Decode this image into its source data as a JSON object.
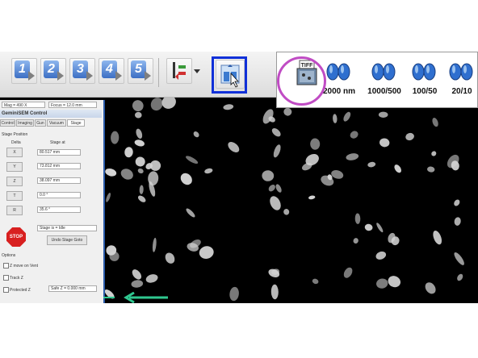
{
  "toolbar": {
    "numbers": [
      "1",
      "2",
      "3",
      "4",
      "5"
    ]
  },
  "mag_panel": {
    "items": [
      {
        "label": "2000 nm"
      },
      {
        "label": "1000/500"
      },
      {
        "label": "100/50"
      },
      {
        "label": "20/10"
      }
    ],
    "tiff_label": "TIFF"
  },
  "left_panel": {
    "mag_readout": "Mag =    490 X",
    "focus_readout": "Focus = 12.0 mm",
    "title": "GeminiSEM Control",
    "tabs": [
      "Control",
      "Imaging",
      "Gun",
      "Vacuum",
      "Stage"
    ],
    "section_stage_position": "Stage Position",
    "col_delta": "Delta",
    "col_stage_at": "Stage at",
    "axes": [
      {
        "name": "X",
        "value": "80.517 mm"
      },
      {
        "name": "Y",
        "value": "73.812 mm"
      },
      {
        "name": "Z",
        "value": "38.097 mm"
      },
      {
        "name": "T",
        "value": "0.0 °"
      },
      {
        "name": "R",
        "value": "35.6 °"
      }
    ],
    "stop_label": "STOP",
    "stage_status": "Stage is = Idle",
    "undo_button": "Undo Stage Goto",
    "options_label": "Options",
    "z_move_label": "Z move on Vent",
    "track_z_label": "Track Z",
    "protected_z_label": "Protected Z",
    "safe_z_label": "Safe Z =  0.000 mm"
  },
  "colors": {
    "highlight_blue": "#1030d8",
    "circle_magenta": "#c04cc4",
    "arrow_green": "#2fc890",
    "stop_red": "#d82020"
  }
}
